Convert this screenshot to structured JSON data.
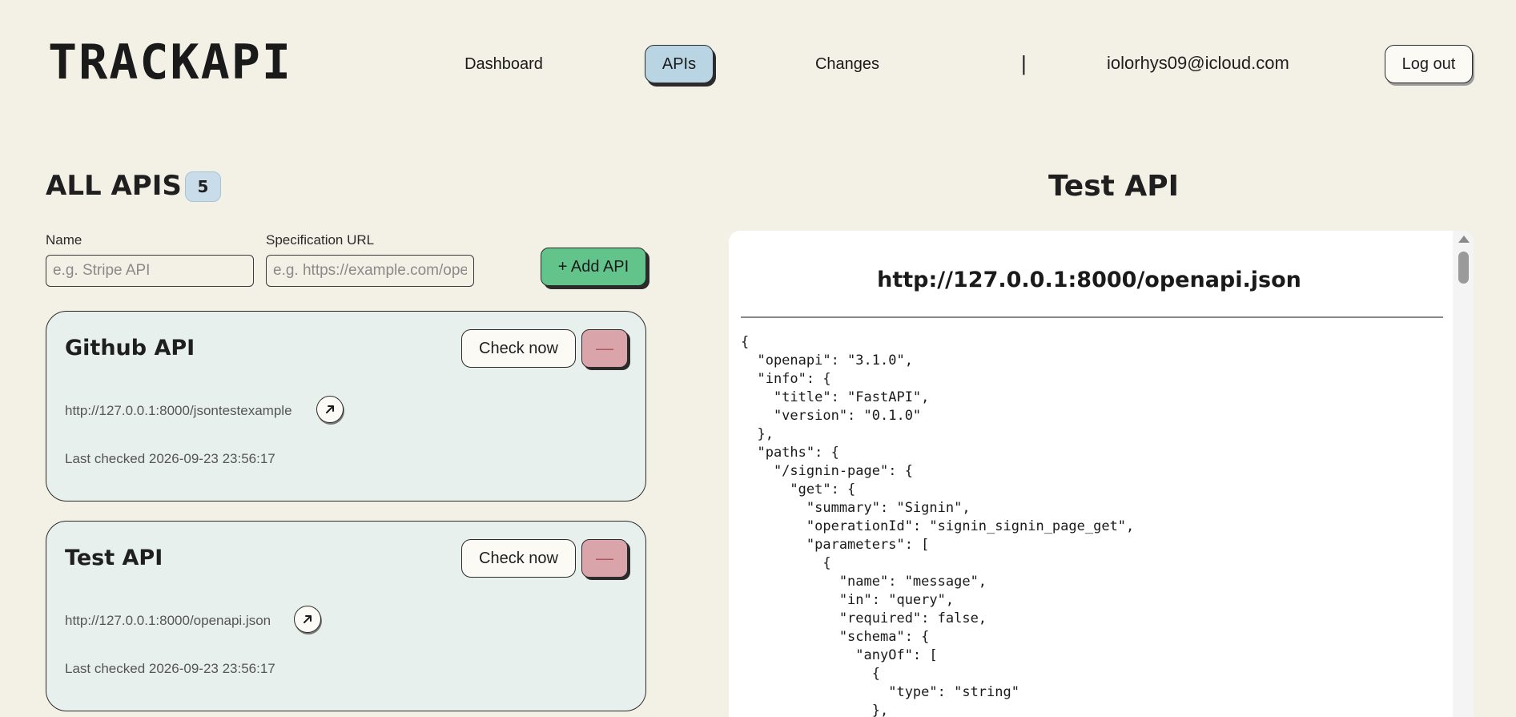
{
  "header": {
    "logo": "TRACKAPI",
    "nav": {
      "dashboard": "Dashboard",
      "apis": "APIs",
      "changes": "Changes"
    },
    "separator": "|",
    "user_email": "iolorhys09@icloud.com",
    "logout_label": "Log out"
  },
  "list": {
    "title": "ALL APIS",
    "count": "5",
    "form": {
      "name_label": "Name",
      "name_placeholder": "e.g. Stripe API",
      "spec_label": "Specification URL",
      "spec_placeholder": "e.g. https://example.com/openapi.json",
      "add_label": "+ Add API"
    },
    "apis": [
      {
        "name": "Github API",
        "url": "http://127.0.0.1:8000/jsontestexample",
        "last_checked": "Last checked 2026-09-23 23:56:17",
        "check_label": "Check now",
        "remove_label": "—"
      },
      {
        "name": "Test API",
        "url": "http://127.0.0.1:8000/openapi.json",
        "last_checked": "Last checked 2026-09-23 23:56:17",
        "check_label": "Check now",
        "remove_label": "—"
      }
    ]
  },
  "detail": {
    "title": "Test API",
    "spec_url": "http://127.0.0.1:8000/openapi.json",
    "spec_json": "{\n  \"openapi\": \"3.1.0\",\n  \"info\": {\n    \"title\": \"FastAPI\",\n    \"version\": \"0.1.0\"\n  },\n  \"paths\": {\n    \"/signin-page\": {\n      \"get\": {\n        \"summary\": \"Signin\",\n        \"operationId\": \"signin_signin_page_get\",\n        \"parameters\": [\n          {\n            \"name\": \"message\",\n            \"in\": \"query\",\n            \"required\": false,\n            \"schema\": {\n              \"anyOf\": [\n                {\n                  \"type\": \"string\"\n                },"
  }
}
